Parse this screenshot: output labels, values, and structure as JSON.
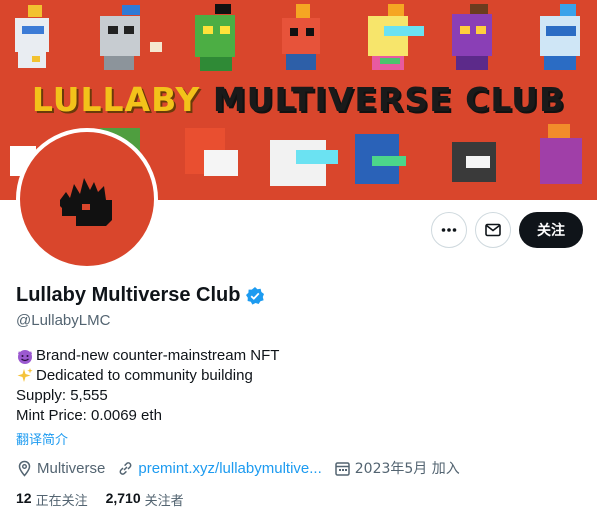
{
  "banner": {
    "title_part1": "LULLABY",
    "title_part2": " MULTIVERSE CLUB",
    "background_color": "#d9462c"
  },
  "avatar": {
    "background_color": "#d9462c",
    "icon": "flame-logo-icon"
  },
  "actions": {
    "more_icon": "more-icon",
    "message_icon": "mail-icon",
    "follow_label": "关注"
  },
  "profile": {
    "display_name": "Lullaby Multiverse Club",
    "verified_icon": "verified-badge-icon",
    "handle": "@LullabyLMC"
  },
  "bio": {
    "line1": "Brand-new counter-mainstream NFT",
    "line1_emoji": "smiling-devil-icon",
    "line2": "Dedicated to community building",
    "line2_emoji": "sparkles-icon",
    "line3": "Supply: 5,555",
    "line4": "Mint Price: 0.0069 eth"
  },
  "translate_label": "翻译简介",
  "meta": {
    "location": "Multiverse",
    "website": "premint.xyz/lullabymultive...",
    "joined": "2023年5月 加入"
  },
  "stats": {
    "following_count": "12",
    "following_label": "正在关注",
    "followers_count": "2,710",
    "followers_label": "关注者"
  },
  "colors": {
    "link": "#1d9bf0",
    "secondary_text": "#536471",
    "primary_text": "#0f1419",
    "verified": "#1d9bf0"
  }
}
